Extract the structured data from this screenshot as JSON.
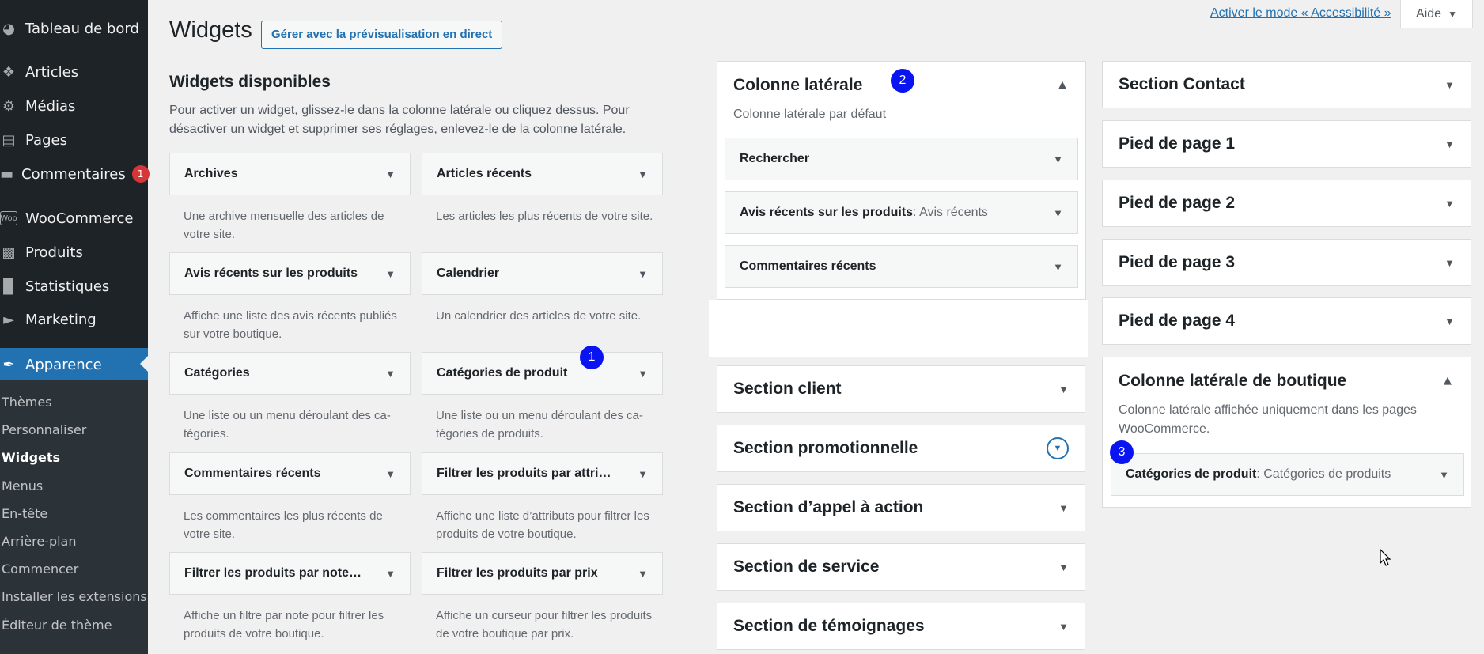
{
  "sidebar": {
    "items": [
      {
        "label": "Tableau de bord",
        "icon": "dashboard-icon"
      },
      {
        "label": "Articles",
        "icon": "pin-icon"
      },
      {
        "label": "Médias",
        "icon": "media-icon"
      },
      {
        "label": "Pages",
        "icon": "pages-icon"
      },
      {
        "label": "Commentaires",
        "icon": "comment-icon",
        "badge": "1"
      },
      {
        "label": "WooCommerce",
        "icon": "woo-icon"
      },
      {
        "label": "Produits",
        "icon": "archive-icon"
      },
      {
        "label": "Statistiques",
        "icon": "chart-bar-icon"
      },
      {
        "label": "Marketing",
        "icon": "megaphone-icon"
      },
      {
        "label": "Apparence",
        "icon": "paintbrush-icon"
      }
    ],
    "submenu": [
      "Thèmes",
      "Personnaliser",
      "Widgets",
      "Menus",
      "En-tête",
      "Arrière-plan",
      "Commencer",
      "Installer les extensions",
      "Éditeur de thème"
    ]
  },
  "header": {
    "title": "Widgets",
    "live_button": "Gérer avec la prévisualisation en direct",
    "accessibility_link": "Activer le mode « Accessibilité »",
    "help_label": "Aide"
  },
  "available": {
    "title": "Widgets disponibles",
    "description": "Pour activer un widget, glissez-le dans la colonne latérale ou cliquez dessus. Pour désactiver un widget et supprimer ses réglages, enlevez-le de la colonne latérale.",
    "widgets": [
      {
        "name": "Archives",
        "desc": "Une archive mensuelle des articles de votre site."
      },
      {
        "name": "Articles récents",
        "desc": "Les articles les plus récents de votre site."
      },
      {
        "name": "Avis récents sur les produits",
        "desc": "Affiche une liste des avis récents publiés sur votre boutique."
      },
      {
        "name": "Calendrier",
        "desc": "Un calendrier des articles de votre site."
      },
      {
        "name": "Catégories",
        "desc": "Une liste ou un menu déroulant des ca­tégories."
      },
      {
        "name": "Catégories de produit",
        "desc": "Une liste ou un menu déroulant des ca­tégories de produits."
      },
      {
        "name": "Commentaires récents",
        "desc": "Les commentaires les plus récents de votre site."
      },
      {
        "name": "Filtrer les produits par attri…",
        "desc": "Affiche une liste d’attributs pour filtrer les produits de votre boutique."
      },
      {
        "name": "Filtrer les produits par note…",
        "desc": "Affiche un filtre par note pour filtrer les produits de votre boutique."
      },
      {
        "name": "Filtrer les produits par prix",
        "desc": "Affiche un curseur pour filtrer les pro­duits de votre boutique par prix."
      }
    ]
  },
  "sidebar_area": {
    "title": "Colonne latérale",
    "description": "Colonne latérale par défaut",
    "widgets": [
      {
        "name": "Rechercher",
        "sub": ""
      },
      {
        "name": "Avis récents sur les produits",
        "sub": "Avis récents"
      },
      {
        "name": "Commentaires récents",
        "sub": ""
      }
    ]
  },
  "middle_areas": [
    "Section client",
    "Section promotionnelle",
    "Section d’appel à action",
    "Section de service",
    "Section de témoignages"
  ],
  "right_areas": [
    "Section Contact",
    "Pied de page 1",
    "Pied de page 2",
    "Pied de page 3",
    "Pied de page 4"
  ],
  "shop_area": {
    "title": "Colonne latérale de boutique",
    "description": "Colonne latérale affichée uniquement dans les pages WooCommerce.",
    "widget_name": "Catégories de produit",
    "widget_sub": "Catégories de produits"
  },
  "markers": [
    "1",
    "2",
    "3"
  ],
  "colors": {
    "accent": "#2271b1",
    "sidebar_bg": "#1d2327",
    "marker": "#0a14f0",
    "badge": "#d63638"
  }
}
